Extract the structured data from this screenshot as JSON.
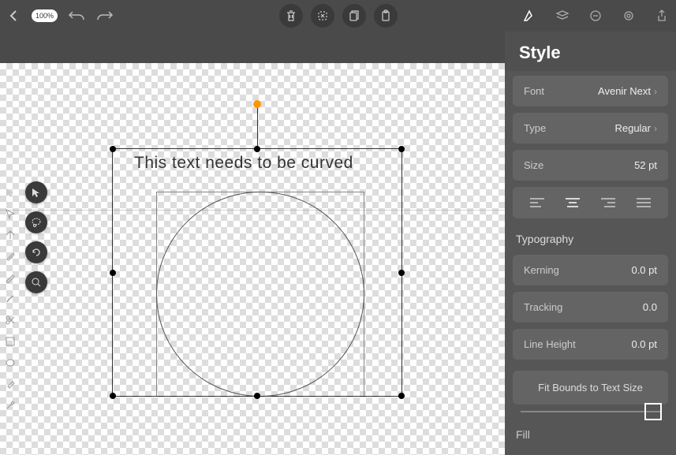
{
  "topbar": {
    "zoom": "100%"
  },
  "canvas": {
    "text": "This text needs to be curved"
  },
  "panel": {
    "title": "Style",
    "font": {
      "label": "Font",
      "value": "Avenir Next"
    },
    "type": {
      "label": "Type",
      "value": "Regular"
    },
    "size": {
      "label": "Size",
      "value": "52 pt"
    },
    "typography_title": "Typography",
    "kerning": {
      "label": "Kerning",
      "value": "0.0 pt"
    },
    "tracking": {
      "label": "Tracking",
      "value": "0.0"
    },
    "line_height": {
      "label": "Line Height",
      "value": "0.0 pt"
    },
    "fit_bounds": "Fit Bounds to Text Size",
    "fill": "Fill"
  }
}
